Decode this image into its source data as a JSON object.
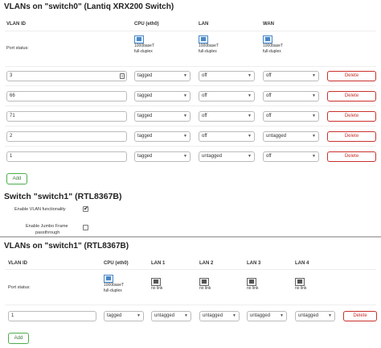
{
  "switch0": {
    "title": "VLANs on \"switch0\" (Lantiq XRX200 Switch)",
    "headers": [
      "VLAN ID",
      "CPU (eth0)",
      "LAN",
      "WAN"
    ],
    "port_status_label": "Port status:",
    "ports": [
      {
        "speed": "1000baseT",
        "duplex": "full-duplex",
        "icon": "ethernet-port-icon"
      },
      {
        "speed": "1000baseT",
        "duplex": "full-duplex",
        "icon": "ethernet-port-icon"
      },
      {
        "speed": "1000baseT",
        "duplex": "full-duplex",
        "icon": "ethernet-port-icon"
      }
    ],
    "rows": [
      {
        "vlan_id": "3",
        "cpu": "tagged",
        "lan": "off",
        "wan": "off"
      },
      {
        "vlan_id": "66",
        "cpu": "tagged",
        "lan": "off",
        "wan": "off"
      },
      {
        "vlan_id": "71",
        "cpu": "tagged",
        "lan": "off",
        "wan": "off"
      },
      {
        "vlan_id": "2",
        "cpu": "tagged",
        "lan": "off",
        "wan": "untagged"
      },
      {
        "vlan_id": "1",
        "cpu": "tagged",
        "lan": "untagged",
        "wan": "off"
      }
    ],
    "delete_label": "Delete",
    "add_label": "Add"
  },
  "switch1_settings": {
    "title": "Switch \"switch1\" (RTL8367B)",
    "enable_vlan_label": "Enable VLAN functionality",
    "enable_vlan_checked": true,
    "jumbo_label_line1": "Enable Jumbo Frame",
    "jumbo_label_line2": "passthrough",
    "jumbo_checked": false
  },
  "switch1": {
    "title": "VLANs on \"switch1\" (RTL8367B)",
    "headers": [
      "VLAN ID",
      "CPU (eth0)",
      "LAN 1",
      "LAN 2",
      "LAN 3",
      "LAN 4"
    ],
    "port_status_label": "Port status:",
    "ports": [
      {
        "line1": "1000baseT",
        "line2": "full-duplex",
        "icon": "ethernet-port-icon"
      },
      {
        "line1": "no link",
        "line2": "",
        "icon": "ethernet-port-nolink-icon"
      },
      {
        "line1": "no link",
        "line2": "",
        "icon": "ethernet-port-nolink-icon"
      },
      {
        "line1": "no link",
        "line2": "",
        "icon": "ethernet-port-nolink-icon"
      },
      {
        "line1": "no link",
        "line2": "",
        "icon": "ethernet-port-nolink-icon"
      }
    ],
    "rows": [
      {
        "vlan_id": "1",
        "cpu": "tagged",
        "lan1": "untagged",
        "lan2": "untagged",
        "lan3": "untagged",
        "lan4": "untagged"
      }
    ],
    "delete_label": "Delete",
    "add_label": "Add"
  },
  "colors": {
    "delete": "#c9302c",
    "add": "#4cae4c"
  }
}
